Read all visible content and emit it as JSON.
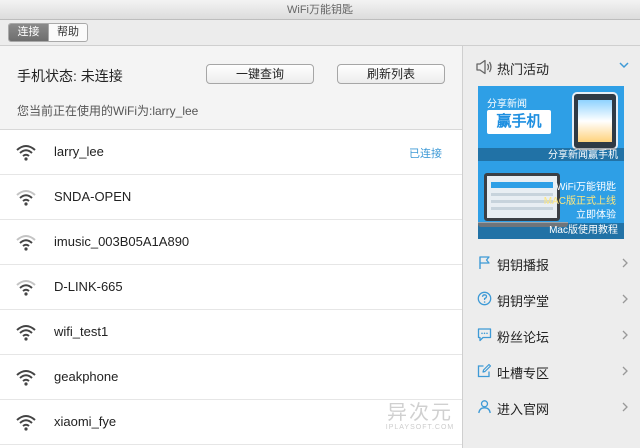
{
  "window": {
    "title": "WiFi万能钥匙"
  },
  "tabs": [
    {
      "label": "连接",
      "active": true
    },
    {
      "label": "帮助",
      "active": false
    }
  ],
  "status": {
    "text": "手机状态: 未连接",
    "current_wifi": "您当前正在使用的WiFi为:larry_lee"
  },
  "buttons": {
    "one_key_query": "一键查询",
    "refresh_list": "刷新列表"
  },
  "wifi_list": [
    {
      "name": "larry_lee",
      "state": "已连接",
      "signal": "wifi-strong-icon"
    },
    {
      "name": "SNDA-OPEN",
      "state": "",
      "signal": "wifi-medium-icon"
    },
    {
      "name": "imusic_003B05A1A890",
      "state": "",
      "signal": "wifi-medium-icon"
    },
    {
      "name": "D-LINK-665",
      "state": "",
      "signal": "wifi-medium-icon"
    },
    {
      "name": "wifi_test1",
      "state": "",
      "signal": "wifi-strong-icon"
    },
    {
      "name": "geakphone",
      "state": "",
      "signal": "wifi-strong-icon"
    },
    {
      "name": "xiaomi_fye",
      "state": "",
      "signal": "wifi-strong-icon"
    }
  ],
  "sidebar": {
    "hot_title": "热门活动",
    "banner1": {
      "tag": "分享新闻",
      "headline": "赢手机",
      "caption": "分享新闻赢手机"
    },
    "banner2": {
      "line1": "WiFi万能钥匙",
      "line2": "MAC版正式上线",
      "line3": "立即体验",
      "caption": "Mac版使用教程"
    },
    "menu": [
      {
        "label": "钥钥播报",
        "icon": "flag-icon"
      },
      {
        "label": "钥钥学堂",
        "icon": "question-icon"
      },
      {
        "label": "粉丝论坛",
        "icon": "chat-icon"
      },
      {
        "label": "吐槽专区",
        "icon": "edit-icon"
      },
      {
        "label": "进入官网",
        "icon": "user-icon"
      }
    ]
  },
  "watermark": {
    "cn": "异次元",
    "en": "IPLAYSOFT.COM"
  },
  "colors": {
    "accent": "#3e9ad6",
    "banner": "#2e9fe6"
  }
}
